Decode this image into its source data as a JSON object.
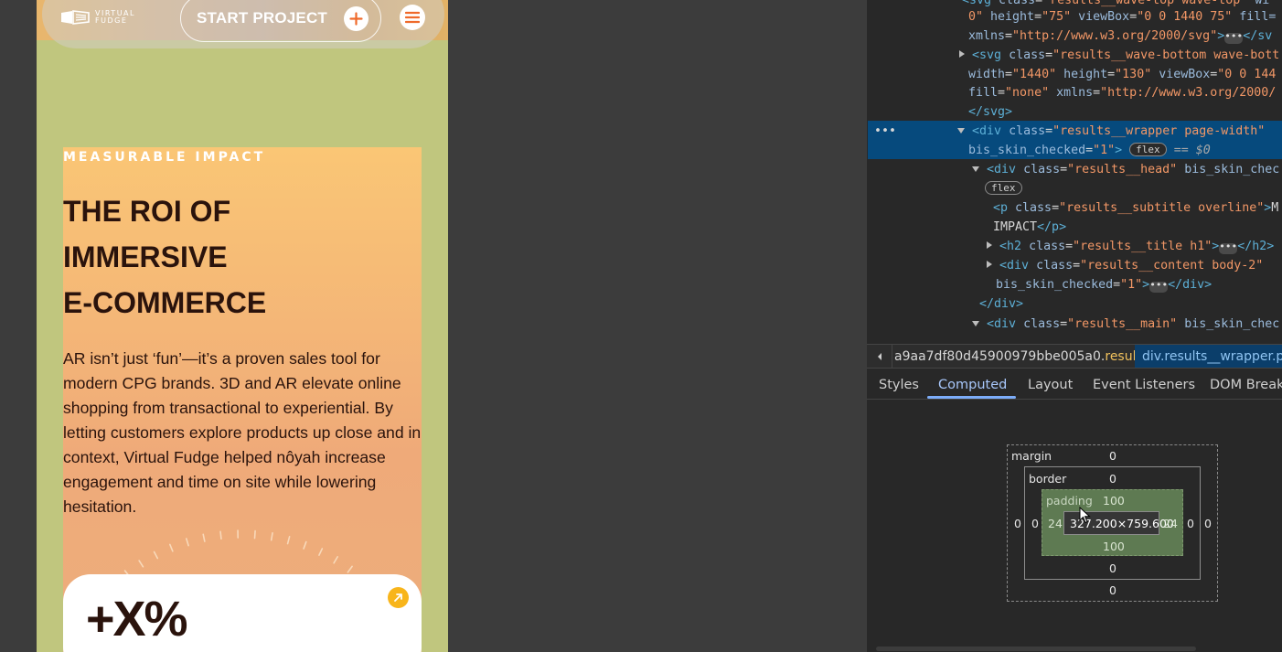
{
  "website": {
    "logo": {
      "text": "VIRTUAL FUDGE"
    },
    "header": {
      "cta_label": "START PROJECT"
    },
    "results": {
      "overline": "MEASURABLE IMPACT",
      "title_lines": [
        "THE ROI OF",
        "IMMERSIVE",
        "E-COMMERCE"
      ],
      "body": "AR isn’t just ‘fun’—it’s a proven sales tool for modern CPG brands. 3D and AR elevate online shopping from transactional to experiential. By letting customers explore products up close and in context, Virtual Fudge helped nôyah increase engagement and time on site while lowering hesitation.",
      "card_value": "+X%"
    },
    "colors": {
      "page_bg": "#c0c67e",
      "wrapper_top": "#fac675",
      "wrapper_bottom": "#ecae7c",
      "text": "#2a130c",
      "plus_icon": "#ef6a2b",
      "arrow_badge": "#f8b51b"
    }
  },
  "devtools": {
    "elements": {
      "l1": {
        "tag": "<svg",
        "class_attr": "class",
        "class_val": "\"results__wave-top wave-top\"",
        "rest_attr": "wi"
      },
      "l2": {
        "text_a": "0\"",
        "attr1": "height",
        "val1": "\"75\"",
        "attr2": "viewBox",
        "val2": "\"0 0 1440 75\"",
        "attr3": "fill="
      },
      "l3": {
        "attr": "xmlns",
        "val": "\"http://www.w3.org/2000/svg\"",
        "ell": "•••",
        "close": "</sv"
      },
      "l4": {
        "tag": "<svg",
        "attr": "class",
        "val": "\"results__wave-bottom wave-bott"
      },
      "l5": {
        "attr1": "width",
        "val1": "\"1440\"",
        "attr2": "height",
        "val2": "\"130\"",
        "attr3": "viewBox",
        "val3": "\"0 0 144"
      },
      "l6": {
        "attr1": "fill",
        "val1": "\"none\"",
        "attr2": "xmlns",
        "val2": "\"http://www.w3.org/2000/"
      },
      "l7": {
        "close": "</svg>"
      },
      "l8": {
        "gutter": "•••",
        "tag": "<div",
        "attr": "class",
        "val": "\"results__wrapper page-width\""
      },
      "l9": {
        "attr": "bis_skin_checked",
        "val": "\"1\"",
        "close": ">",
        "badge": "flex",
        "eq": "==",
        "dollar": "$0"
      },
      "l10": {
        "tag": "<div",
        "attr": "class",
        "val": "\"results__head\"",
        "attr2": "bis_skin_chec"
      },
      "l11": {
        "badge": "flex"
      },
      "l12": {
        "tag": "<p",
        "attr": "class",
        "val": "\"results__subtitle overline\"",
        "close": ">",
        "text": "M"
      },
      "l13": {
        "text": "IMPACT",
        "close": "</p>"
      },
      "l14": {
        "tag": "<h2",
        "attr": "class",
        "val": "\"results__title h1\"",
        "close": ">",
        "ell": "•••",
        "close2": "</h2>"
      },
      "l15": {
        "tag": "<div",
        "attr": "class",
        "val": "\"results__content body-2\""
      },
      "l16": {
        "attr": "bis_skin_checked",
        "val": "\"1\"",
        "close": ">",
        "ell": "•••",
        "close2": "</div>"
      },
      "l17": {
        "close": "</div>"
      },
      "l18": {
        "tag": "<div",
        "attr": "class",
        "val": "\"results__main\"",
        "attr2": "bis_skin_chec"
      }
    },
    "breadcrumbs": {
      "first_hash": "a9aa7df80d45900979bbe005a0.",
      "first_class": "results",
      "second": "div.results__wrapper.pa"
    },
    "tabs": [
      "Styles",
      "Computed",
      "Layout",
      "Event Listeners",
      "DOM Breakp"
    ],
    "active_tab": "Computed",
    "box_model": {
      "margin_label": "margin",
      "margin": {
        "top": "0",
        "right": "0",
        "bottom": "0",
        "left": "0"
      },
      "border_label": "border",
      "border": {
        "top": "0",
        "right": "0",
        "bottom": "0",
        "left": "0"
      },
      "padding_label": "padding",
      "padding": {
        "top": "100",
        "right": "24",
        "bottom": "100",
        "left": "24"
      },
      "content": "327.200×759.600"
    }
  }
}
